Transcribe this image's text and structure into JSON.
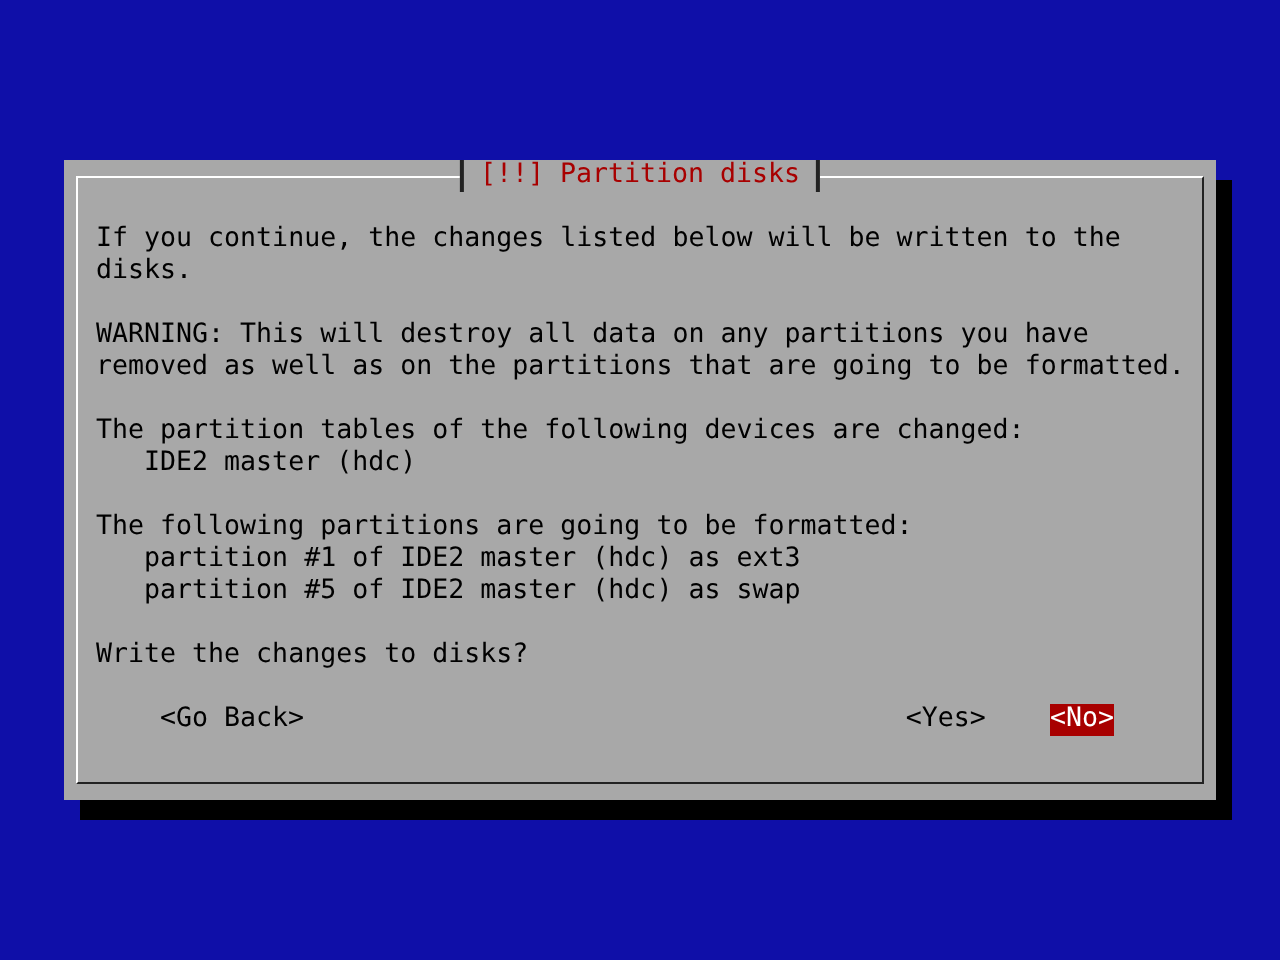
{
  "dialog": {
    "title": "[!!] Partition disks",
    "paragraphs": [
      {
        "text": "If you continue, the changes listed below will be written to the disks."
      },
      {
        "text": "WARNING: This will destroy all data on any partitions you have removed as well as on the partitions that are going to be formatted."
      },
      {
        "text": "The partition tables of the following devices are changed:",
        "items": [
          "IDE2 master (hdc)"
        ]
      },
      {
        "text": "The following partitions are going to be formatted:",
        "items": [
          "partition #1 of IDE2 master (hdc) as ext3",
          "partition #5 of IDE2 master (hdc) as swap"
        ]
      },
      {
        "text": "Write the changes to disks?"
      }
    ],
    "buttons": [
      {
        "label": "<Go Back>",
        "selected": false
      },
      {
        "label": "<Yes>",
        "selected": false
      },
      {
        "label": "<No>",
        "selected": true
      }
    ]
  }
}
